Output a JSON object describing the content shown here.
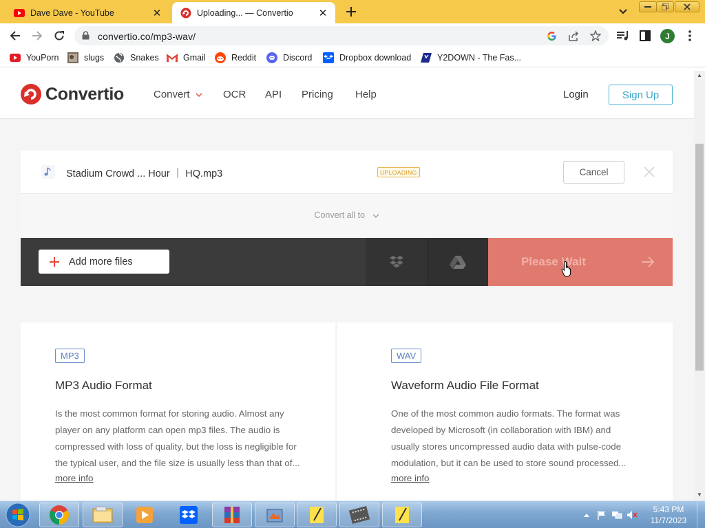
{
  "browser": {
    "tabs": [
      {
        "title": "Dave Dave - YouTube",
        "active": false
      },
      {
        "title": "Uploading... — Convertio",
        "active": true
      }
    ],
    "url": "convertio.co/mp3-wav/",
    "profile_initial": "J",
    "bookmarks": [
      {
        "label": "YouPorn",
        "icon": "youporn-icon"
      },
      {
        "label": "slugs",
        "icon": "image-icon"
      },
      {
        "label": "Snakes",
        "icon": "globe-icon"
      },
      {
        "label": "Gmail",
        "icon": "gmail-icon"
      },
      {
        "label": "Reddit",
        "icon": "reddit-icon"
      },
      {
        "label": "Discord",
        "icon": "discord-icon"
      },
      {
        "label": "Dropbox download",
        "icon": "dropbox-icon"
      },
      {
        "label": "Y2DOWN - The Fas...",
        "icon": "y2down-icon"
      }
    ]
  },
  "site": {
    "logo_text": "Convertio",
    "nav": [
      "Convert",
      "OCR",
      "API",
      "Pricing",
      "Help"
    ],
    "login_label": "Login",
    "signup_label": "Sign Up"
  },
  "upload": {
    "file_name": "Stadium Crowd ... Hour ｜ HQ.mp3",
    "status_badge": "UPLOADING",
    "cancel_label": "Cancel",
    "convert_all_label": "Convert all to",
    "add_files_label": "Add more files",
    "wait_label": "Please Wait"
  },
  "formats": [
    {
      "badge": "MP3",
      "title": "MP3 Audio Format",
      "description": "Is the most common format for storing audio. Almost any player on any platform can open mp3 files. The audio is compressed with loss of quality, but the loss is negligible for the typical user, and the file size is usually less than that of...",
      "more_label": "more info"
    },
    {
      "badge": "WAV",
      "title": "Waveform Audio File Format",
      "description": "One of the most common audio formats. The format was developed by Microsoft (in collaboration with IBM) and usually stores uncompressed audio data with pulse-code modulation, but it can be used to store sound processed...",
      "more_label": "more info"
    }
  ],
  "taskbar": {
    "time": "5:43 PM",
    "date": "11/7/2023"
  },
  "colors": {
    "tabstrip": "#f6c94a",
    "brand_red": "#d9302b",
    "wait_button": "#e07a6e",
    "signup_border": "#4bb3d6",
    "badge_blue": "#5b7fc2"
  }
}
